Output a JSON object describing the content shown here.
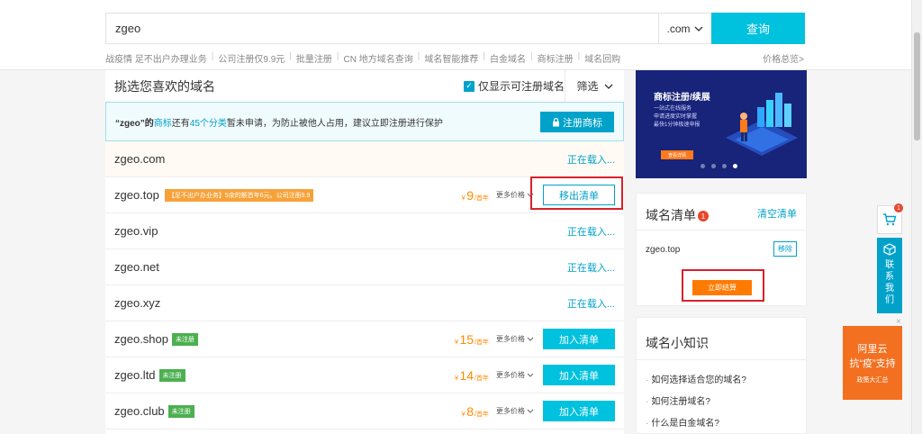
{
  "search": {
    "value": "zgeo",
    "suffix": ".com",
    "query_label": "查询",
    "hot_links": [
      "战疫情 足不出户办理业务",
      "公司注册仅9.9元",
      "批量注册",
      "CN 地方域名查询",
      "域名智能推荐",
      "白金域名",
      "商标注册",
      "域名回购"
    ],
    "price_link": "价格总览>"
  },
  "list": {
    "title": "挑选您喜欢的域名",
    "only_available": "仅显示可注册域名",
    "filter_label": "筛选",
    "notice_prefix": "“zgeo”的",
    "notice_tm": "商标",
    "notice_mid": "还有",
    "notice_count": "45个分类",
    "notice_suffix": "暂未申请，为防止被他人占用，建议立即注册进行保护",
    "register_tm_label": "注册商标",
    "loading_label": "正在载入...",
    "more_price_label": "更多价格",
    "per_year": "/首年",
    "currency": "￥",
    "add_label": "加入清单",
    "remove_label": "移出清单",
    "unregistered_tag": "未注册",
    "rows": [
      {
        "domain": "zgeo.com"
      },
      {
        "domain": "zgeo.top",
        "promo": "【足不出户办业务】5余的额首年6元。公司注册9.9",
        "price": "9"
      },
      {
        "domain": "zgeo.vip"
      },
      {
        "domain": "zgeo.net"
      },
      {
        "domain": "zgeo.xyz"
      },
      {
        "domain": "zgeo.shop",
        "price": "15"
      },
      {
        "domain": "zgeo.ltd",
        "price": "14"
      },
      {
        "domain": "zgeo.club",
        "price": "8"
      }
    ]
  },
  "banner": {
    "title": "商标注册/续展",
    "sub1": "一站式在线服务",
    "sub2": "申请进度实时掌握",
    "sub3": "最快1分钟极速申报",
    "btn": "查看详情"
  },
  "cart": {
    "title": "域名清单",
    "badge": "1",
    "clear_label": "清空清单",
    "item": "zgeo.top",
    "remove_label": "移除",
    "checkout_label": "立即结算"
  },
  "tips": {
    "title": "域名小知识",
    "items": [
      "如何选择适合您的域名?",
      "如何注册域名?",
      "什么是白金域名?"
    ]
  },
  "float": {
    "cart_badge": "1",
    "contact_label": "联系我们",
    "promo_l1": "阿里云",
    "promo_l2": "抗“疫”支持",
    "promo_l3": "政策大汇总",
    "close": "×"
  },
  "colors": {
    "accent": "#00c1de",
    "orange": "#ff8a00",
    "highlight": "#d8212a",
    "tag_green": "#4cb050"
  }
}
